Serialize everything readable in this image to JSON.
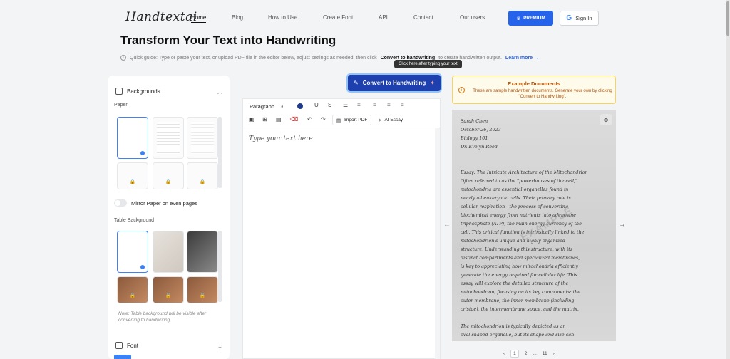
{
  "header": {
    "logo": "Handtextai",
    "nav": [
      "Home",
      "Blog",
      "How to Use",
      "Create Font",
      "API",
      "Contact",
      "Our users"
    ],
    "premium_label": "PREMIUM",
    "signin_label": "Sign In"
  },
  "title": "Transform Your Text into Handwriting",
  "guide": {
    "text": "Quick guide: Type or paste your text, or upload PDF file in the editor below, adjust settings as needed, then click",
    "bold": "Convert to handwriting",
    "text2": "to create handwritten output.",
    "more": "Learn more →"
  },
  "left": {
    "backgrounds_label": "Backgrounds",
    "paper_label": "Paper",
    "mirror_label": "Mirror Paper on even pages",
    "table_bg_label": "Table Background",
    "note": "Note: Table background will be visible after converting to handwriting",
    "font_label": "Font"
  },
  "editor": {
    "convert_label": "Convert to Handwriting",
    "tooltip": "Click here after typing your text",
    "paragraph": "Paragraph",
    "import_pdf": "Import PDF",
    "ai_essay": "AI Essay",
    "placeholder": "Type your text here"
  },
  "example": {
    "title": "Example Documents",
    "text": "These are sample handwritten documents. Generate your own by clicking \"Convert to Handwriting\".",
    "watermark": "EXAMPLE",
    "lines": [
      "Sarah Chen",
      "October 26, 2023",
      "Biology 101",
      "Dr. Evelyn Reed",
      "",
      "",
      "Essay: The Intricate Architecture of the Mitochondrion",
      "Often referred to as the \"powerhouses of the cell,\"",
      "mitochondria are essential organelles found in",
      "nearly all eukaryotic cells. Their primary role is",
      "cellular respiration - the process of converting",
      "biochemical energy from nutrients into adenosine",
      "triphosphate (ATP), the main energy currency of the",
      "cell. This critical function is intrinsically linked to the",
      "mitochondrion's unique and highly organized",
      "structure. Understanding this structure, with its",
      "distinct compartments and specialized membranes,",
      "is key to appreciating how mitochondria efficiently",
      "generate the energy required for cellular life. This",
      "essay will explore the detailed structure of the",
      "mitochondrion, focusing on its key components: the",
      "outer membrane, the inner membrane (including",
      "cristae), the intermembrane space, and the matrix.",
      "",
      "The mitochondrion is typically depicted as an",
      "oval-shaped organelle, but its shape and size can"
    ]
  },
  "pager": [
    "1",
    "2",
    "...",
    "11"
  ]
}
